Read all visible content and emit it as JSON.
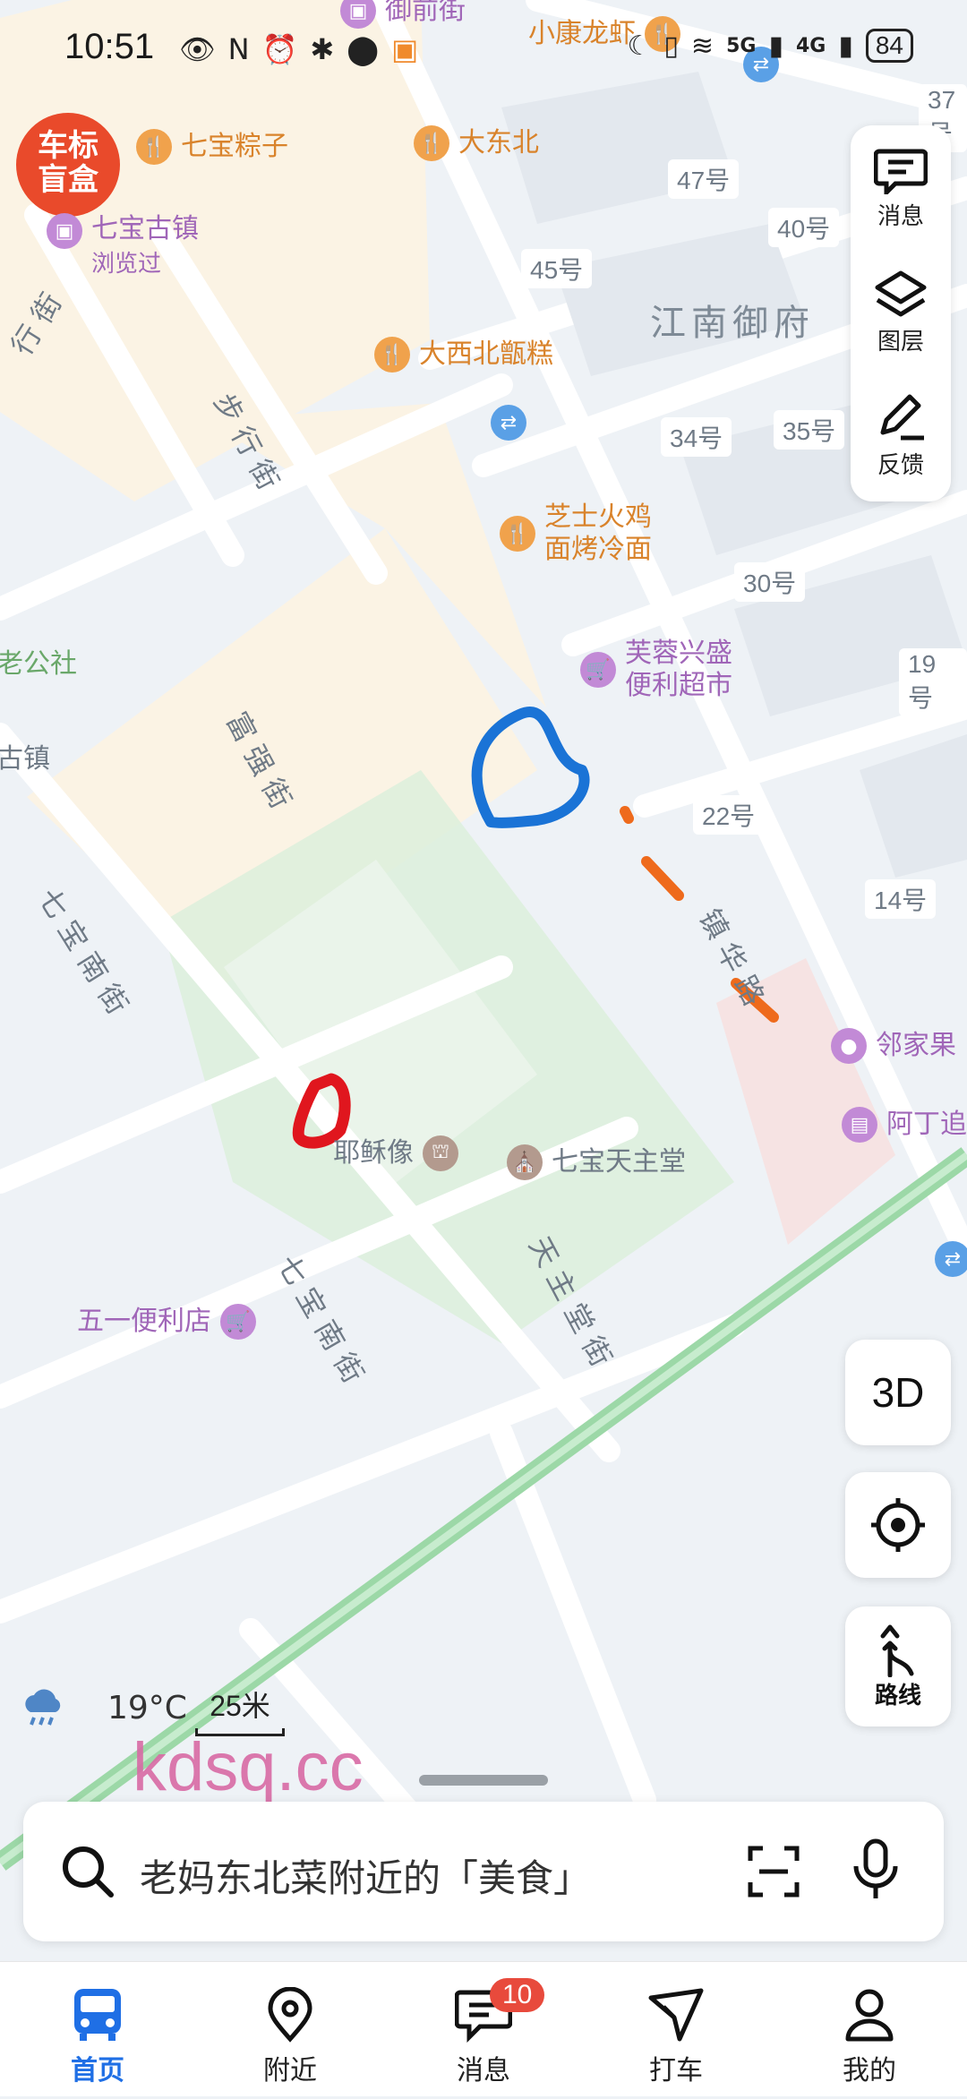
{
  "status_bar": {
    "time": "10:51",
    "battery": "84",
    "network_1": "5G",
    "network_2": "4G"
  },
  "colors": {
    "accent": "#1f6fe5",
    "green_road": "#9cd8a7",
    "map_block": "#fbf3e4",
    "badge": "#e84a3c",
    "watermark": "#d86aa5"
  },
  "map": {
    "district": "江南御府",
    "badge_logo": "车标\n盲盒",
    "pois": [
      {
        "name": "七宝粽子",
        "icon": "fork-knife-icon"
      },
      {
        "name": "大东北",
        "icon": "fork-knife-icon"
      },
      {
        "name": "七宝古镇",
        "icon": "shopping-bag-icon",
        "sub": "浏览过"
      },
      {
        "name": "大西北甑糕",
        "icon": "fork-knife-icon"
      },
      {
        "name": "芝士火鸡\n面烤冷面",
        "icon": "fork-knife-icon"
      },
      {
        "name": "芙蓉兴盛\n便利超市",
        "icon": "cart-icon"
      },
      {
        "name": "邻家果",
        "icon": "fruit-store-icon"
      },
      {
        "name": "阿丁追",
        "icon": "store-icon"
      },
      {
        "name": "耶稣像",
        "icon": "statue-icon"
      },
      {
        "name": "七宝天主堂",
        "icon": "church-icon"
      },
      {
        "name": "五一便利店",
        "icon": "cart-icon"
      },
      {
        "name": "御前街",
        "icon": "shopping-bag-icon"
      },
      {
        "name": "小康龙虾",
        "icon": "fork-knife-icon"
      },
      {
        "name": "老公社",
        "icon": ""
      },
      {
        "name": "古镇",
        "icon": ""
      }
    ],
    "streets": [
      "步行街",
      "富强街",
      "七宝南街",
      "七宝南街",
      "天主堂街",
      "镇华路",
      "行街"
    ],
    "house_numbers": [
      "37号",
      "47号",
      "40号",
      "45号",
      "34号",
      "35号",
      "30号",
      "19号",
      "22号",
      "14号"
    ]
  },
  "side_tools": {
    "messages": "消息",
    "layers": "图层",
    "feedback": "反馈"
  },
  "controls": {
    "btn_3d": "3D",
    "route": "路线"
  },
  "weather": {
    "temp": "19°C"
  },
  "scale": {
    "label": "25米"
  },
  "watermark": "kdsq.cc",
  "search": {
    "placeholder": "老妈东北菜附近的「美食」"
  },
  "nav": {
    "home": "首页",
    "nearby": "附近",
    "messages": "消息",
    "messages_badge": "10",
    "taxi": "打车",
    "mine": "我的"
  }
}
